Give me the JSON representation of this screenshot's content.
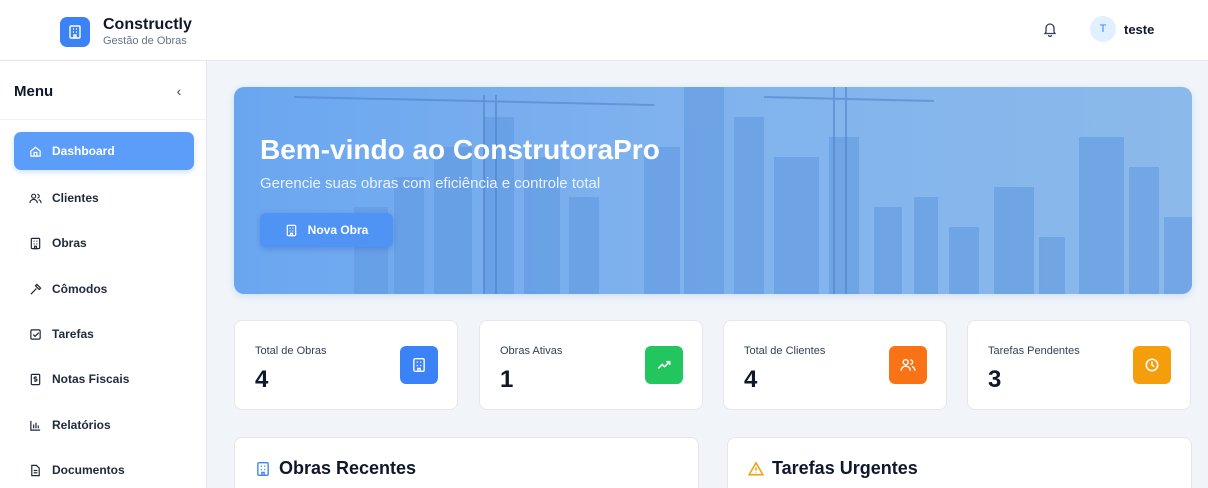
{
  "header": {
    "brand_name": "Constructly",
    "brand_subtitle": "Gestão de Obras",
    "brand_icon": "building-icon",
    "notification_icon": "bell-icon",
    "user_initial": "T",
    "user_name": "teste"
  },
  "sidebar": {
    "title": "Menu",
    "collapse_icon": "chevron-left-icon",
    "items": [
      {
        "label": "Dashboard",
        "icon": "home-icon",
        "active": true
      },
      {
        "label": "Clientes",
        "icon": "users-icon",
        "active": false
      },
      {
        "label": "Obras",
        "icon": "building-icon",
        "active": false
      },
      {
        "label": "Cômodos",
        "icon": "hammer-icon",
        "active": false
      },
      {
        "label": "Tarefas",
        "icon": "checkbox-icon",
        "active": false
      },
      {
        "label": "Notas Fiscais",
        "icon": "invoice-icon",
        "active": false
      },
      {
        "label": "Relatórios",
        "icon": "bar-chart-icon",
        "active": false
      },
      {
        "label": "Documentos",
        "icon": "document-icon",
        "active": false
      }
    ]
  },
  "hero": {
    "title": "Bem-vindo ao ConstrutoraPro",
    "subtitle": "Gerencie suas obras com eficiência e controle total",
    "button_label": "Nova Obra"
  },
  "stats": [
    {
      "label": "Total de Obras",
      "value": "4",
      "icon": "building-icon",
      "color": "#3b82f6"
    },
    {
      "label": "Obras Ativas",
      "value": "1",
      "icon": "trending-up-icon",
      "color": "#22c55e"
    },
    {
      "label": "Total de Clientes",
      "value": "4",
      "icon": "users-icon",
      "color": "#f97316"
    },
    {
      "label": "Tarefas Pendentes",
      "value": "3",
      "icon": "clock-icon",
      "color": "#f59e0b"
    }
  ],
  "panels": {
    "recent_title": "Obras Recentes",
    "urgent_title": "Tarefas Urgentes"
  },
  "colors": {
    "accent": "#3b82f6",
    "active_nav": "#5b9df8"
  }
}
